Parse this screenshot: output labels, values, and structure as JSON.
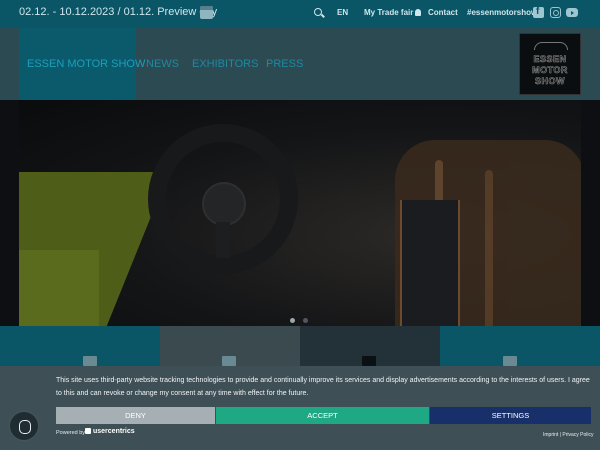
{
  "topbar": {
    "dates": "02.12. - 10.12.2023 / 01.12. Preview day",
    "language": "EN",
    "my_trade_fair": "My Trade fair",
    "contact": "Contact",
    "hashtag": "#essenmotorshow"
  },
  "nav": {
    "items": [
      {
        "label": "ESSEN MOTOR SHOW"
      },
      {
        "label": "NEWS"
      },
      {
        "label": "EXHIBITORS"
      },
      {
        "label": "PRESS"
      }
    ],
    "logo_lines": [
      "ESSEN",
      "MOTOR",
      "SHOW"
    ]
  },
  "hero": {
    "slide_count": 2,
    "active_slide": 1
  },
  "consent": {
    "text": "This site uses third-party website tracking technologies to provide and continually improve its services and display advertisements according to the interests of users. I agree to this and can revoke or change my consent at any time with effect for the future.",
    "deny_label": "DENY",
    "accept_label": "ACCEPT",
    "settings_label": "SETTINGS",
    "powered_by": "Powered by",
    "brand": "usercentrics",
    "links": "Imprint | Privacy Policy"
  },
  "colors": {
    "accent_teal": "#0a5566",
    "accept_green": "#1fa884",
    "settings_navy": "#18306a",
    "deny_gray": "#a6b0b4"
  }
}
